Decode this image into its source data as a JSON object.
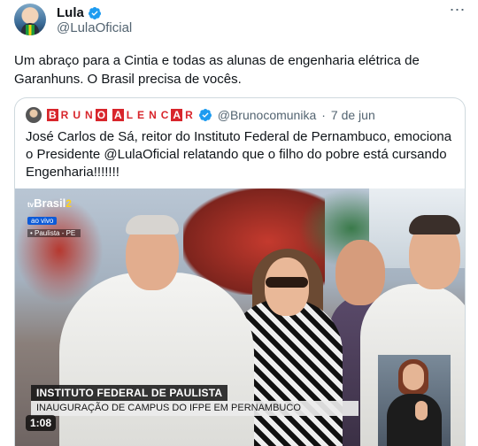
{
  "author": {
    "name": "Lula",
    "handle": "@LulaOficial"
  },
  "more_icon": "⋯",
  "tweet_text": "Um abraço para a Cintia e todas as alunas de engenharia elétrica de Garanhuns. O Brasil precisa de vocês.",
  "quoted": {
    "name_letters": [
      "B",
      "R",
      "U",
      "N",
      "O",
      "A",
      "L",
      "E",
      "N",
      "C",
      "A",
      "R"
    ],
    "handle": "@Brunocomunika",
    "separator": "·",
    "date": "7 de jun",
    "text": "José Carlos de Sá, reitor do Instituto Federal de Pernambuco, emociona o Presidente @LulaOficial relatando que o filho do pobre está cursando Engenharia!!!!!!!"
  },
  "video": {
    "channel_tv": "tv",
    "channel_name": "Brasil",
    "channel_num": "2",
    "live_label": "ao vivo",
    "location": "• Paulista - PE",
    "caption_title": "INSTITUTO FEDERAL DE PAULISTA",
    "caption_sub": "INAUGURAÇÃO DE CAMPUS DO IFPE EM PERNAMBUCO",
    "duration": "1:08"
  },
  "colors": {
    "verified": "#1d9bf0",
    "text_secondary": "#536471",
    "brand_red": "#d8262c"
  }
}
